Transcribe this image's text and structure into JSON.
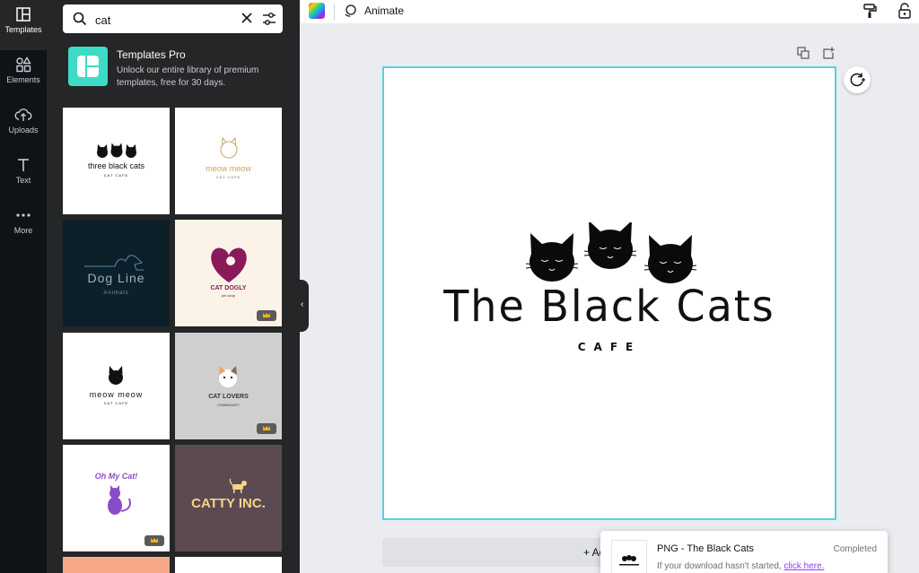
{
  "rail": {
    "items": [
      {
        "label": "Templates",
        "icon": "layout-icon"
      },
      {
        "label": "Elements",
        "icon": "shapes-icon"
      },
      {
        "label": "Uploads",
        "icon": "cloud-upload-icon"
      },
      {
        "label": "Text",
        "icon": "text-icon"
      },
      {
        "label": "More",
        "icon": "more-dots-icon"
      }
    ]
  },
  "search": {
    "value": "cat"
  },
  "promo": {
    "title": "Templates Pro",
    "description": "Unlock our entire library of premium templates, free for 30 days."
  },
  "templates": [
    {
      "title": "three black cats",
      "sub": "CAT CAFE",
      "bg": "#ffffff"
    },
    {
      "title": "meow meow",
      "sub": "CAT CAFE",
      "bg": "#ffffff"
    },
    {
      "title": "Dog Line",
      "sub": "Animals",
      "bg": "#0d1f29"
    },
    {
      "title": "CAT DOGLY",
      "sub": "pet shop",
      "bg": "#fbf3e7"
    },
    {
      "title": "meow meow",
      "sub": "CAT CAFE",
      "bg": "#ffffff"
    },
    {
      "title": "CAT LOVERS",
      "sub": "COMMUNITY",
      "bg": "#cfcfcf"
    },
    {
      "title": "Oh My Cat!",
      "sub": "",
      "bg": "#ffffff"
    },
    {
      "title": "CATTY INC.",
      "sub": "",
      "bg": "#5c4a52"
    }
  ],
  "topbar": {
    "animate_label": "Animate"
  },
  "canvas": {
    "title": "The Black Cats",
    "subtitle": "CAFE"
  },
  "add_page": {
    "label": "+ Add"
  },
  "toast": {
    "name": "PNG - The Black Cats",
    "status": "Completed",
    "note": "If your download hasn't started, ",
    "link": "click here."
  },
  "colors": {
    "accent": "#57d1e2",
    "panel": "#252627",
    "rail": "#0e1318",
    "promo": "#3ddac6",
    "link": "#8b3dff"
  }
}
